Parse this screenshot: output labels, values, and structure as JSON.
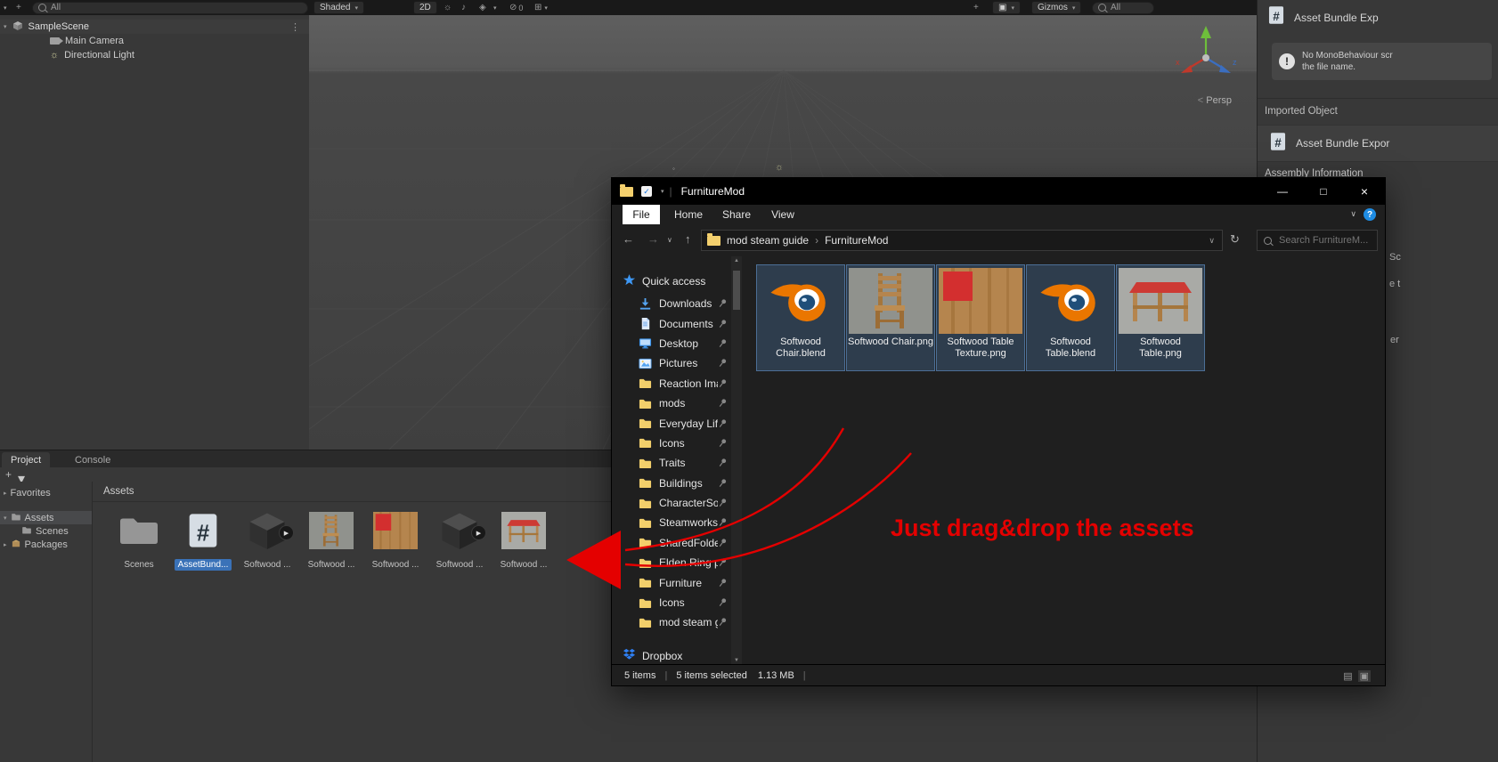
{
  "icons": {
    "caret_down": "▾",
    "caret_right": "▸",
    "chevron_down": "∨",
    "chevron_right": "›",
    "back": "←",
    "forward": "→",
    "up": "↑",
    "refresh": "↻",
    "minimize": "—",
    "maximize": "□",
    "close": "×",
    "menu_dots": "⋮",
    "plus": "+",
    "play": "▶",
    "light": "☼",
    "audio": "♪",
    "fx": "◈",
    "hidden": "⊘",
    "grid": "⊞",
    "scroll_up": "▲",
    "scroll_down": "▼",
    "persp_prefix": "<",
    "warning": "!",
    "help": "?",
    "check": "✓",
    "list_view": "▤",
    "thumb_view": "▣"
  },
  "colors": {
    "annotation_red": "#e40000",
    "selection_blue": "#3a72b8"
  },
  "unity": {
    "toolbar": {
      "search_filter": "All",
      "shaded_mode": "Shaded",
      "mode_2d": "2D",
      "hidden_count": "0",
      "gizmos": "Gizmos",
      "search_right": "All"
    },
    "hierarchy": {
      "scene_name": "SampleScene",
      "items": [
        {
          "label": "Main Camera"
        },
        {
          "label": "Directional Light"
        }
      ]
    },
    "scene_view": {
      "projection": "Persp"
    },
    "tabs": {
      "project": "Project",
      "console": "Console"
    },
    "project": {
      "favorites": "Favorites",
      "tree": [
        {
          "label": "Assets"
        },
        {
          "label": "Scenes"
        },
        {
          "label": "Packages"
        }
      ],
      "header": "Assets",
      "items": [
        {
          "label": "Scenes",
          "kind": "folder",
          "selected": false
        },
        {
          "label": "AssetBund...",
          "kind": "script",
          "selected": true
        },
        {
          "label": "Softwood ...",
          "kind": "model",
          "selected": false
        },
        {
          "label": "Softwood ...",
          "kind": "chair",
          "selected": false
        },
        {
          "label": "Softwood ...",
          "kind": "texture",
          "selected": false
        },
        {
          "label": "Softwood ...",
          "kind": "model",
          "selected": false
        },
        {
          "label": "Softwood ...",
          "kind": "table",
          "selected": false
        }
      ]
    },
    "inspector": {
      "title": "Asset Bundle Exp",
      "warning_line1": "No MonoBehaviour scr",
      "warning_line2": "the file name.",
      "imported_object": "Imported Object",
      "imported_title": "Asset Bundle Expor",
      "assembly_header": "Assembly Information",
      "fragments": [
        {
          "text": "Sc"
        },
        {
          "text": "e t"
        },
        {
          "text": "er"
        }
      ]
    }
  },
  "explorer": {
    "window_title": "FurnitureMod",
    "menu": [
      {
        "label": "File"
      },
      {
        "label": "Home"
      },
      {
        "label": "Share"
      },
      {
        "label": "View"
      }
    ],
    "breadcrumb": {
      "parent": "mod steam guide",
      "current": "FurnitureMod"
    },
    "search_placeholder": "Search FurnitureM...",
    "sidebar": {
      "quick_access": "Quick access",
      "items": [
        {
          "label": "Downloads",
          "icon": "downloads"
        },
        {
          "label": "Documents",
          "icon": "documents"
        },
        {
          "label": "Desktop",
          "icon": "desktop"
        },
        {
          "label": "Pictures",
          "icon": "pictures"
        },
        {
          "label": "Reaction Ima",
          "icon": "folder"
        },
        {
          "label": "mods",
          "icon": "folder"
        },
        {
          "label": "Everyday Life",
          "icon": "folder"
        },
        {
          "label": "Icons",
          "icon": "folder"
        },
        {
          "label": "Traits",
          "icon": "folder"
        },
        {
          "label": "Buildings",
          "icon": "folder"
        },
        {
          "label": "CharacterSou",
          "icon": "folder"
        },
        {
          "label": "SteamworksS",
          "icon": "folder"
        },
        {
          "label": "SharedFolder",
          "icon": "folder"
        },
        {
          "label": "Elden Ring p",
          "icon": "folder"
        },
        {
          "label": "Furniture",
          "icon": "folder"
        },
        {
          "label": "Icons",
          "icon": "folder"
        },
        {
          "label": "mod steam g",
          "icon": "folder"
        }
      ],
      "dropbox": "Dropbox"
    },
    "files": [
      {
        "name": "Softwood Chair.blend",
        "kind": "blender"
      },
      {
        "name": "Softwood Chair.png",
        "kind": "chair"
      },
      {
        "name": "Softwood Table Texture.png",
        "kind": "texture"
      },
      {
        "name": "Softwood Table.blend",
        "kind": "blender"
      },
      {
        "name": "Softwood Table.png",
        "kind": "table"
      }
    ],
    "status": {
      "count": "5 items",
      "selected": "5 items selected",
      "size": "1.13 MB"
    }
  },
  "annotation": {
    "text": "Just drag&drop the assets"
  }
}
